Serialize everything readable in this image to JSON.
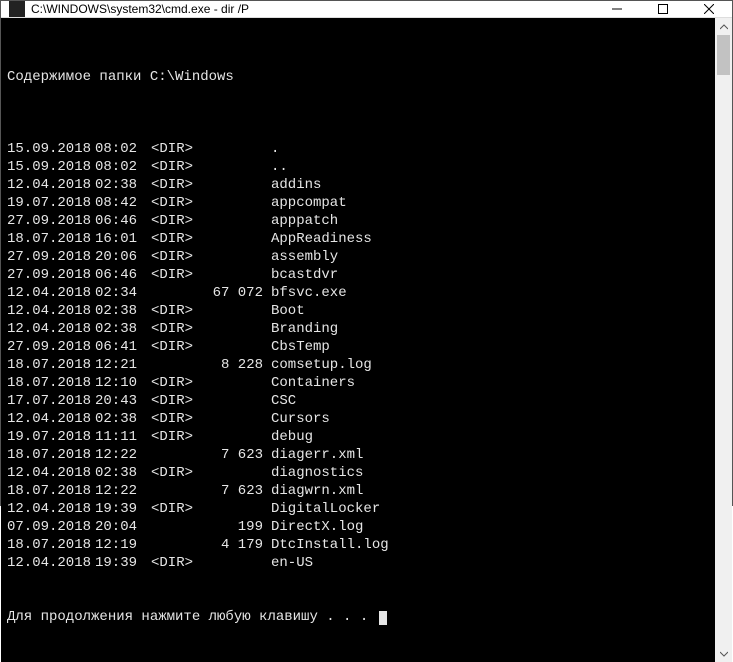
{
  "window": {
    "title": "C:\\WINDOWS\\system32\\cmd.exe - dir  /P"
  },
  "console": {
    "header": "Содержимое папки C:\\Windows",
    "footer": "Для продолжения нажмите любую клавишу . . . ",
    "rows": [
      {
        "date": "15.09.2018",
        "time": "08:02",
        "type": "<DIR>",
        "size": "",
        "name": "."
      },
      {
        "date": "15.09.2018",
        "time": "08:02",
        "type": "<DIR>",
        "size": "",
        "name": ".."
      },
      {
        "date": "12.04.2018",
        "time": "02:38",
        "type": "<DIR>",
        "size": "",
        "name": "addins"
      },
      {
        "date": "19.07.2018",
        "time": "08:42",
        "type": "<DIR>",
        "size": "",
        "name": "appcompat"
      },
      {
        "date": "27.09.2018",
        "time": "06:46",
        "type": "<DIR>",
        "size": "",
        "name": "apppatch"
      },
      {
        "date": "18.07.2018",
        "time": "16:01",
        "type": "<DIR>",
        "size": "",
        "name": "AppReadiness"
      },
      {
        "date": "27.09.2018",
        "time": "20:06",
        "type": "<DIR>",
        "size": "",
        "name": "assembly"
      },
      {
        "date": "27.09.2018",
        "time": "06:46",
        "type": "<DIR>",
        "size": "",
        "name": "bcastdvr"
      },
      {
        "date": "12.04.2018",
        "time": "02:34",
        "type": "",
        "size": "67 072",
        "name": "bfsvc.exe"
      },
      {
        "date": "12.04.2018",
        "time": "02:38",
        "type": "<DIR>",
        "size": "",
        "name": "Boot"
      },
      {
        "date": "12.04.2018",
        "time": "02:38",
        "type": "<DIR>",
        "size": "",
        "name": "Branding"
      },
      {
        "date": "27.09.2018",
        "time": "06:41",
        "type": "<DIR>",
        "size": "",
        "name": "CbsTemp"
      },
      {
        "date": "18.07.2018",
        "time": "12:21",
        "type": "",
        "size": "8 228",
        "name": "comsetup.log"
      },
      {
        "date": "18.07.2018",
        "time": "12:10",
        "type": "<DIR>",
        "size": "",
        "name": "Containers"
      },
      {
        "date": "17.07.2018",
        "time": "20:43",
        "type": "<DIR>",
        "size": "",
        "name": "CSC"
      },
      {
        "date": "12.04.2018",
        "time": "02:38",
        "type": "<DIR>",
        "size": "",
        "name": "Cursors"
      },
      {
        "date": "19.07.2018",
        "time": "11:11",
        "type": "<DIR>",
        "size": "",
        "name": "debug"
      },
      {
        "date": "18.07.2018",
        "time": "12:22",
        "type": "",
        "size": "7 623",
        "name": "diagerr.xml"
      },
      {
        "date": "12.04.2018",
        "time": "02:38",
        "type": "<DIR>",
        "size": "",
        "name": "diagnostics"
      },
      {
        "date": "18.07.2018",
        "time": "12:22",
        "type": "",
        "size": "7 623",
        "name": "diagwrn.xml"
      },
      {
        "date": "12.04.2018",
        "time": "19:39",
        "type": "<DIR>",
        "size": "",
        "name": "DigitalLocker"
      },
      {
        "date": "07.09.2018",
        "time": "20:04",
        "type": "",
        "size": "199",
        "name": "DirectX.log"
      },
      {
        "date": "18.07.2018",
        "time": "12:19",
        "type": "",
        "size": "4 179",
        "name": "DtcInstall.log"
      },
      {
        "date": "12.04.2018",
        "time": "19:39",
        "type": "<DIR>",
        "size": "",
        "name": "en-US"
      }
    ]
  }
}
